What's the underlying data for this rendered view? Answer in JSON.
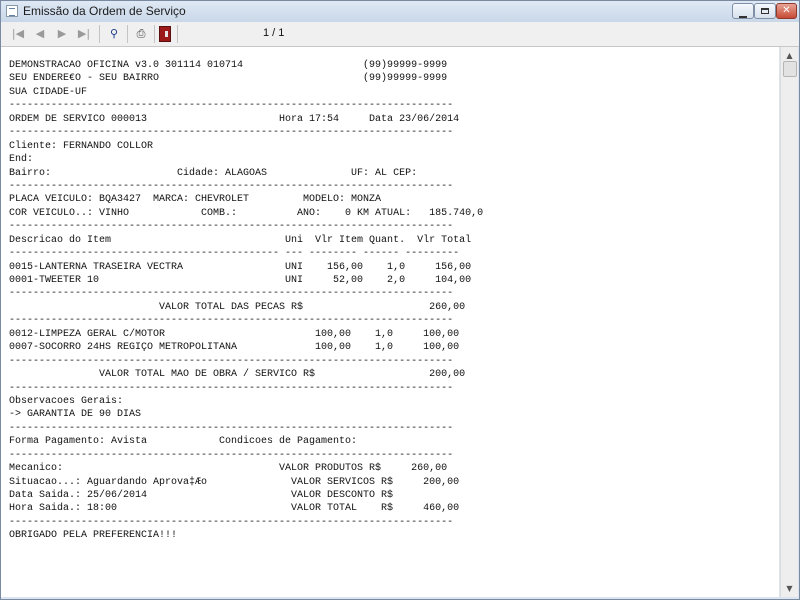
{
  "window": {
    "title": "Emissão da Ordem de Serviço"
  },
  "toolbar": {
    "page_counter": "1 / 1",
    "icons": [
      "first-page-icon",
      "previous-page-icon",
      "next-page-icon",
      "last-page-icon",
      "zoom-icon",
      "print-icon",
      "exit-icon"
    ]
  },
  "report": {
    "lines": [
      "DEMONSTRACAO OFICINA v3.0 301114 010714                    (99)99999-9999",
      "SEU ENDERE€O - SEU BAIRRO                                  (99)99999-9999",
      "SUA CIDADE-UF",
      "--------------------------------------------------------------------------",
      "ORDEM DE SERVICO 000013                      Hora 17:54     Data 23/06/2014",
      "--------------------------------------------------------------------------",
      "Cliente: FERNANDO COLLOR",
      "End:",
      "Bairro:                     Cidade: ALAGOAS              UF: AL CEP:",
      "--------------------------------------------------------------------------",
      "PLACA VEICULO: BQA3427  MARCA: CHEVROLET         MODELO: MONZA",
      "COR VEICULO..: VINHO            COMB.:          ANO:    0 KM ATUAL:   185.740,0",
      "--------------------------------------------------------------------------",
      "Descricao do Item                             Uni  Vlr Item Quant.  Vlr Total",
      "--------------------------------------------- --- -------- ------ ---------",
      "0015-LANTERNA TRASEIRA VECTRA                 UNI    156,00    1,0     156,00",
      "0001-TWEETER 10                               UNI     52,00    2,0     104,00",
      "--------------------------------------------------------------------------",
      "                         VALOR TOTAL DAS PECAS R$                     260,00",
      "--------------------------------------------------------------------------",
      "0012-LIMPEZA GERAL C/MOTOR                         100,00    1,0     100,00",
      "0007-SOCORRO 24HS REGIÇO METROPOLITANA             100,00    1,0     100,00",
      "--------------------------------------------------------------------------",
      "               VALOR TOTAL MAO DE OBRA / SERVICO R$                   200,00",
      "--------------------------------------------------------------------------",
      "Observacoes Gerais:",
      "-> GARANTIA DE 90 DIAS",
      "--------------------------------------------------------------------------",
      "Forma Pagamento: Avista            Condicoes de Pagamento:",
      "--------------------------------------------------------------------------",
      "Mecanico:                                    VALOR PRODUTOS R$     260,00",
      "Situacao...: Aguardando Aprova‡Æo              VALOR SERVICOS R$     200,00",
      "Data Saida.: 25/06/2014                        VALOR DESCONTO R$",
      "Hora Saida.: 18:00                             VALOR TOTAL    R$     460,00",
      "--------------------------------------------------------------------------",
      "OBRIGADO PELA PREFERENCIA!!!"
    ]
  }
}
